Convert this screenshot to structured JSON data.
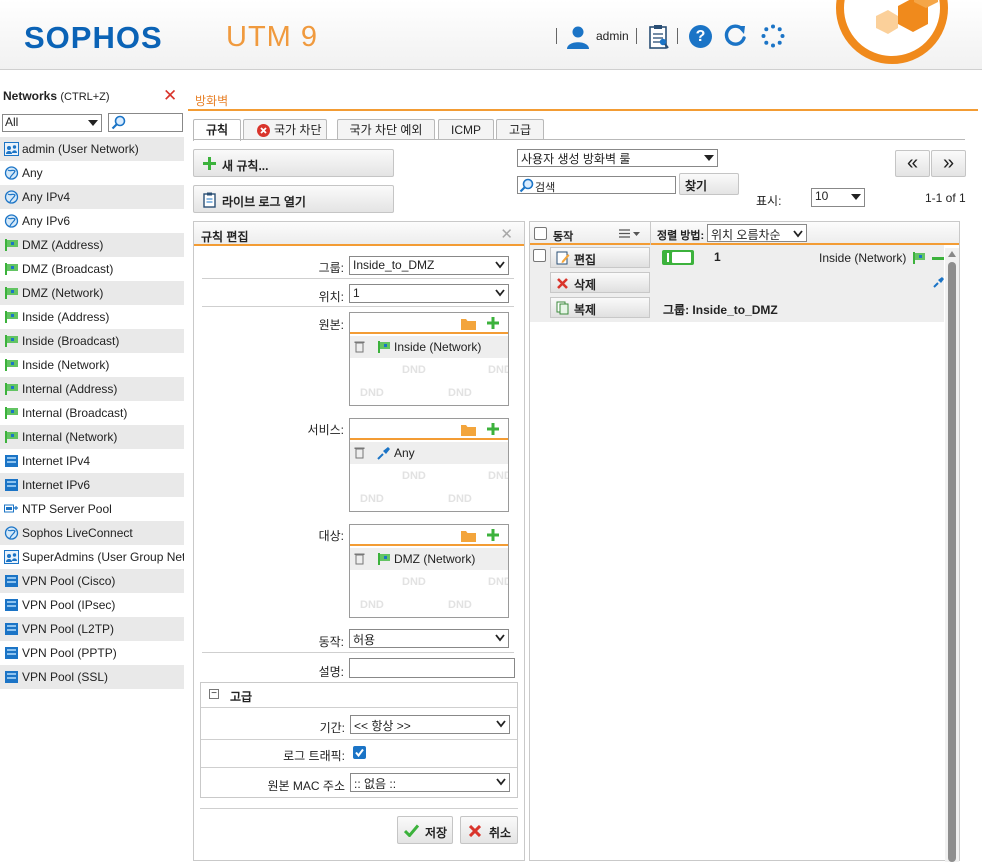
{
  "header": {
    "logo": "SOPHOS",
    "product": "UTM 9",
    "user": "admin"
  },
  "left_panel": {
    "title": "Networks",
    "shortcut": "(CTRL+Z)",
    "filter_value": "All",
    "items": [
      {
        "label": "admin (User Network)",
        "icon": "user-network-icon"
      },
      {
        "label": "Any",
        "icon": "globe-icon"
      },
      {
        "label": "Any IPv4",
        "icon": "globe-icon"
      },
      {
        "label": "Any IPv6",
        "icon": "globe-icon"
      },
      {
        "label": "DMZ (Address)",
        "icon": "interface-address-icon"
      },
      {
        "label": "DMZ (Broadcast)",
        "icon": "interface-address-icon"
      },
      {
        "label": "DMZ (Network)",
        "icon": "interface-address-icon"
      },
      {
        "label": "Inside (Address)",
        "icon": "interface-address-icon"
      },
      {
        "label": "Inside (Broadcast)",
        "icon": "interface-address-icon"
      },
      {
        "label": "Inside (Network)",
        "icon": "interface-address-icon"
      },
      {
        "label": "Internal (Address)",
        "icon": "interface-address-icon"
      },
      {
        "label": "Internal (Broadcast)",
        "icon": "interface-address-icon"
      },
      {
        "label": "Internal (Network)",
        "icon": "interface-address-icon"
      },
      {
        "label": "Internet IPv4",
        "icon": "network-icon"
      },
      {
        "label": "Internet IPv6",
        "icon": "network-icon"
      },
      {
        "label": "NTP Server Pool",
        "icon": "server-pool-icon"
      },
      {
        "label": "Sophos LiveConnect",
        "icon": "globe-icon"
      },
      {
        "label": "SuperAdmins (User Group Net",
        "icon": "user-network-icon"
      },
      {
        "label": "VPN Pool (Cisco)",
        "icon": "network-icon"
      },
      {
        "label": "VPN Pool (IPsec)",
        "icon": "network-icon"
      },
      {
        "label": "VPN Pool (L2TP)",
        "icon": "network-icon"
      },
      {
        "label": "VPN Pool (PPTP)",
        "icon": "network-icon"
      },
      {
        "label": "VPN Pool (SSL)",
        "icon": "network-icon"
      }
    ]
  },
  "main": {
    "breadcrumb": "방화벽",
    "tabs": [
      "규칙",
      "국가 차단",
      "국가 차단 예외",
      "ICMP",
      "고급"
    ],
    "new_rule": "새 규칙...",
    "live_log": "라이브 로그 열기",
    "rule_filter": "사용자 생성 방화벽 룰",
    "search_placeholder": "검색",
    "find": "찾기",
    "display_label": "표시:",
    "display_value": "10",
    "range": "1-1 of 1",
    "prev": "«",
    "next": "»"
  },
  "editor": {
    "title": "규칙 편집",
    "group_label": "그룹:",
    "group_value": "Inside_to_DMZ",
    "position_label": "위치:",
    "position_value": "1",
    "source_label": "원본:",
    "source_entry": "Inside (Network)",
    "service_label": "서비스:",
    "service_entry": "Any",
    "dest_label": "대상:",
    "dest_entry": "DMZ (Network)",
    "dnd": "DND",
    "action_label": "동작:",
    "action_value": "허용",
    "comment_label": "설명:",
    "advanced_title": "고급",
    "time_label": "기간:",
    "time_value": "<< 항상 >>",
    "log_label": "로그 트래픽:",
    "mac_label": "원본 MAC 주소",
    "mac_value": ":: 없음 ::",
    "save": "저장",
    "cancel": "취소"
  },
  "rules_table": {
    "col_action": "동작",
    "sort_label": "정렬 방법:",
    "sort_value": "위치 오름차순",
    "edit": "편집",
    "delete": "삭제",
    "clone": "복제",
    "rule_number": "1",
    "rule_source": "Inside (Network)",
    "rule_group": "그룹: Inside_to_DMZ"
  },
  "colors": {
    "brand_blue": "#0b63b6",
    "accent_orange": "#f39c34",
    "toggle_green": "#3cb23c"
  }
}
